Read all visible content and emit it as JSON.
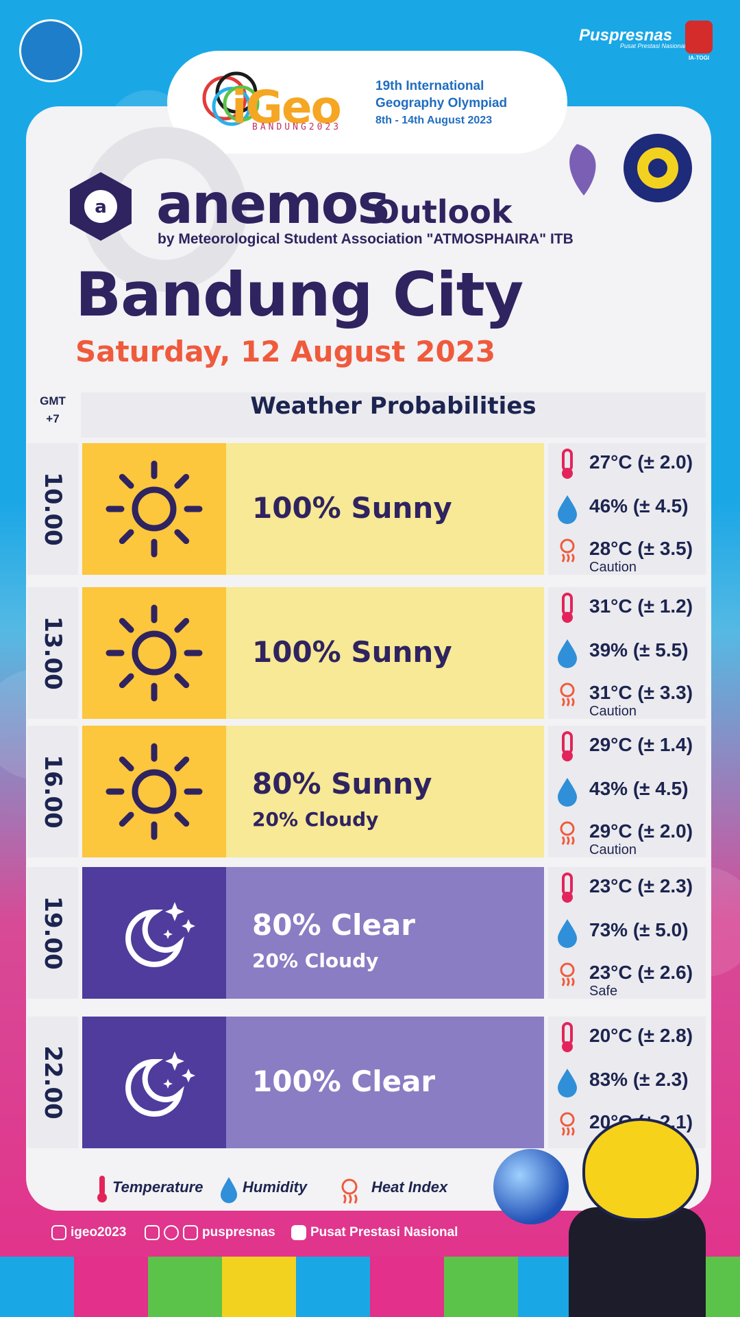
{
  "header": {
    "igeo_logo_word": "iGeo",
    "igeo_logo_sub": "BANDUNG2023",
    "olympiad_line1": "19th International",
    "olympiad_line2": "Geography Olympiad",
    "olympiad_dates": "8th - 14th August 2023",
    "puspresnas": "Puspresnas",
    "puspresnas_tagline": "Pusat Prestasi Nasional",
    "iatogi": "IA-TOGI"
  },
  "brand": {
    "name": "anemos",
    "suffix": "Outlook",
    "byline": "by Meteorological Student Association \"ATMOSPHAIRA\" ITB"
  },
  "city": "Bandung City",
  "date": "Saturday, 12 August 2023",
  "table": {
    "timezone_line1": "GMT",
    "timezone_line2": "+7",
    "header": "Weather Probabilities",
    "rows": [
      {
        "time": "10.00",
        "icon": "sun-icon",
        "cond1": "100% Sunny",
        "cond2": "",
        "temp": "27°C (± 2.0)",
        "humidity": "46% (± 4.5)",
        "heat_index": "28°C (± 3.5)",
        "heat_note": "Caution"
      },
      {
        "time": "13.00",
        "icon": "sun-icon",
        "cond1": "100% Sunny",
        "cond2": "",
        "temp": "31°C (± 1.2)",
        "humidity": "39% (± 5.5)",
        "heat_index": "31°C (± 3.3)",
        "heat_note": "Caution"
      },
      {
        "time": "16.00",
        "icon": "sun-icon",
        "cond1": "80% Sunny",
        "cond2": "20% Cloudy",
        "temp": "29°C (± 1.4)",
        "humidity": "43% (± 4.5)",
        "heat_index": "29°C (± 2.0)",
        "heat_note": "Caution"
      },
      {
        "time": "19.00",
        "icon": "moon-stars-icon",
        "cond1": "80% Clear",
        "cond2": "20% Cloudy",
        "temp": "23°C (± 2.3)",
        "humidity": "73% (± 5.0)",
        "heat_index": "23°C (± 2.6)",
        "heat_note": "Safe"
      },
      {
        "time": "22.00",
        "icon": "moon-stars-icon",
        "cond1": "100% Clear",
        "cond2": "",
        "temp": "20°C (± 2.8)",
        "humidity": "83% (± 2.3)",
        "heat_index": "20°C (± 2.1)",
        "heat_note": ""
      }
    ]
  },
  "legend": {
    "temperature": "Temperature",
    "humidity": "Humidity",
    "heat_index": "Heat Index"
  },
  "social": {
    "instagram": "igeo2023",
    "handles": "puspresnas",
    "youtube": "Pusat Prestasi Nasional"
  },
  "colors": {
    "navy": "#2f2360",
    "accent_orange": "#ef5a3c",
    "sun_icon_bg": "#fcc63d",
    "sun_cond_bg": "#f7e995",
    "moon_icon_bg": "#4f3c9c",
    "moon_cond_bg": "#8a7dc3"
  }
}
